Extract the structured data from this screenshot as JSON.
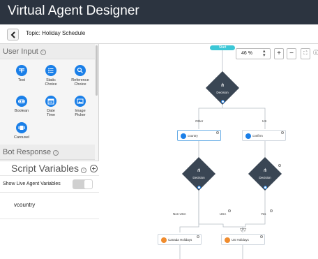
{
  "app": {
    "title": "Virtual Agent Designer"
  },
  "topic": {
    "label": "Topic: Holiday Schedule"
  },
  "sidebar": {
    "user_input": {
      "heading": "User Input",
      "tools": [
        {
          "label": "Text",
          "icon": "text-icon"
        },
        {
          "label": "Static Choice",
          "icon": "list-icon"
        },
        {
          "label": "Reference Choice",
          "icon": "search-icon"
        },
        {
          "label": "Boolean",
          "icon": "toggle-icon"
        },
        {
          "label": "Date Time",
          "icon": "calendar-icon"
        },
        {
          "label": "Image Picker",
          "icon": "image-icon"
        },
        {
          "label": "Carousel",
          "icon": "carousel-icon"
        }
      ]
    },
    "bot_response": {
      "heading": "Bot Response"
    },
    "script_variables": {
      "heading": "Script Variables",
      "show_live_label": "Show Live Agent Variables",
      "items": [
        "vcountry"
      ]
    }
  },
  "canvas": {
    "zoom": "46 %",
    "start_label": "Start",
    "decision_label": "Decision",
    "nodes": {
      "country": "country",
      "confirm": "confirm",
      "canada": "Canada Holidays",
      "us": "US Holidays"
    },
    "edges": {
      "other": "Other",
      "us": "US",
      "non_usa": "Non USA",
      "usa": "USA",
      "yes": "Yes"
    },
    "colors": {
      "accent": "#1a7fe8",
      "decision": "#3a4654",
      "start": "#3cc7d6",
      "orange": "#f08c2e"
    }
  }
}
